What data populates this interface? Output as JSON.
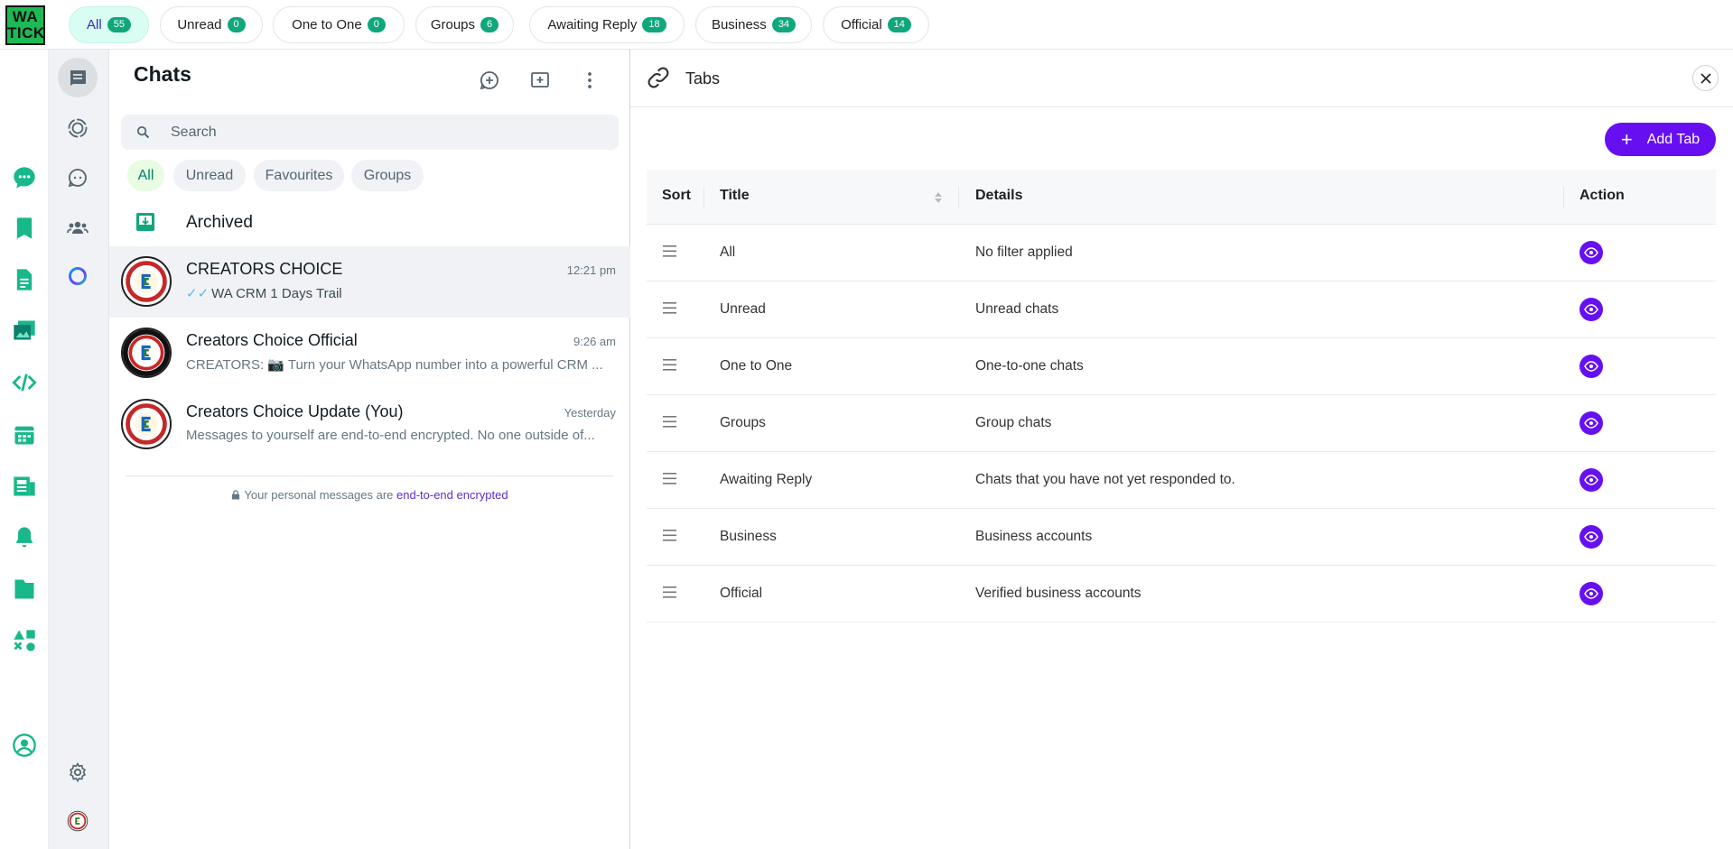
{
  "logo": {
    "line1": "WA",
    "line2": "TICK"
  },
  "filter_tabs": [
    {
      "label": "All",
      "count": "55"
    },
    {
      "label": "Unread",
      "count": "0"
    },
    {
      "label": "One to One",
      "count": "0"
    },
    {
      "label": "Groups",
      "count": "6"
    },
    {
      "label": "Awaiting Reply",
      "count": "18"
    },
    {
      "label": "Business",
      "count": "34"
    },
    {
      "label": "Official",
      "count": "14"
    }
  ],
  "rail_icons": [
    "chat-dots-icon",
    "bookmark-icon",
    "document-icon",
    "photo-icon",
    "code-icon",
    "calendar-icon",
    "newspaper-icon",
    "bell-icon",
    "folder-icon",
    "shapes-icon",
    "account-icon"
  ],
  "nav_icons": [
    "chats-icon",
    "status-icon",
    "channels-icon",
    "communities-icon",
    "meta-ai-icon",
    "settings-icon",
    "profile-avatar"
  ],
  "chats": {
    "title": "Chats",
    "search_placeholder": "Search",
    "pills": [
      "All",
      "Unread",
      "Favourites",
      "Groups"
    ],
    "archived_label": "Archived",
    "list": [
      {
        "name": "CREATORS CHOICE",
        "time": "12:21 pm",
        "preview": "WA CRM 1 Days Trail",
        "ticks": "✓✓"
      },
      {
        "name": "Creators Choice Official",
        "time": "9:26 am",
        "preview": "CREATORS: 📷 Turn your WhatsApp number into a powerful CRM ..."
      },
      {
        "name": "Creators Choice Update (You)",
        "time": "Yesterday",
        "preview": "Messages to yourself are end-to-end encrypted. No one outside of..."
      }
    ],
    "encryption_note": "Your personal messages are ",
    "encryption_link": "end-to-end encrypted"
  },
  "tabs_panel": {
    "title": "Tabs",
    "add_label": "Add Tab",
    "columns": {
      "sort": "Sort",
      "title": "Title",
      "details": "Details",
      "action": "Action"
    },
    "rows": [
      {
        "title": "All",
        "details": "No filter applied"
      },
      {
        "title": "Unread",
        "details": "Unread chats"
      },
      {
        "title": "One to One",
        "details": "One-to-one chats"
      },
      {
        "title": "Groups",
        "details": "Group chats"
      },
      {
        "title": "Awaiting Reply",
        "details": "Chats that you have not yet responded to."
      },
      {
        "title": "Business",
        "details": "Business accounts"
      },
      {
        "title": "Official",
        "details": "Verified business accounts"
      }
    ]
  },
  "colors": {
    "accent": "#6610f2",
    "brand_green": "#0fa77b",
    "active_tab_bg": "#d9fdf3"
  }
}
